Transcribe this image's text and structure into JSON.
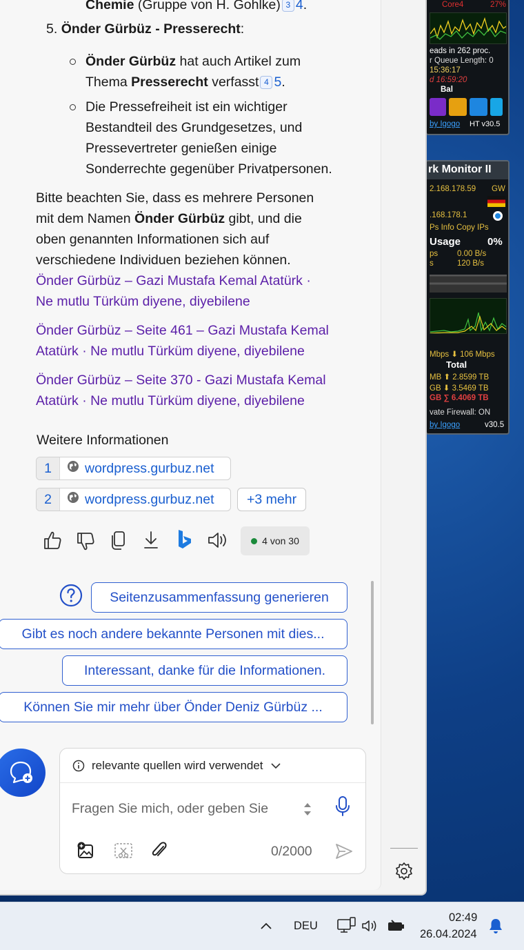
{
  "gadgets": {
    "cpu": {
      "core_label": "Core4",
      "core_value": "27%",
      "threads_line": "eads in 262 proc.",
      "queue_line": "r Queue Length: 0",
      "time1": "15:36:17",
      "time2": "d 16:59:20",
      "bal_label": "Bal",
      "footer": "by Igogo",
      "version": "HT v30.5"
    },
    "network": {
      "title": "rk Monitor II",
      "ip_gateway": "2.168.178.59",
      "gw_label": "GW",
      "ip_local": ".168.178.1",
      "links": "Ps   Info   Copy IPs",
      "usage_label": "Usage",
      "usage_value": "0%",
      "rate_ps": "ps",
      "rate_up": "0.00 B/s",
      "rate_s": "s",
      "rate_down": "120 B/s",
      "speed_line": "Mbps ⬇ 106 Mbps",
      "total_label": "Total",
      "total_up_line": "MB ⬆ 2.8599 TB",
      "total_down_line": "GB ⬇ 3.5469 TB",
      "sum_line": "GB ∑ 6.4069 TB",
      "firewall": "vate   Firewall: ON",
      "footer": "by Igogo",
      "version": "v30.5"
    }
  },
  "chat": {
    "top_line": {
      "bold": "Chemie",
      "rest": " (Gruppe von H. Gohlke)",
      "cite": "3",
      "num": "4",
      "tail": "."
    },
    "item5": {
      "number": "5.",
      "title": "Önder Gürbüz - Presserecht",
      "colon": ":"
    },
    "bullet1": {
      "line1_bold": "Önder Gürbüz",
      "line1_rest": " hat auch Artikel zum",
      "line2_pre": "Thema ",
      "line2_bold": "Presserecht",
      "line2_rest": " verfasst",
      "cite": "4",
      "num": "5",
      "tail": "."
    },
    "bullet2": [
      "Die Pressefreiheit ist ein wichtiger",
      "Bestandteil des Grundgesetzes, und",
      "Pressevertreter genießen einige",
      "Sonderrechte gegenüber Privatpersonen."
    ],
    "note": {
      "line1": "Bitte beachten Sie, dass es mehrere Personen",
      "line2_pre": "mit dem Namen ",
      "line2_bold": "Önder Gürbüz",
      "line2_rest": " gibt, und die",
      "line3": "oben genannten Informationen sich auf",
      "line4": "verschiedene Individuen beziehen können."
    },
    "links": [
      {
        "line1": "Önder Gürbüz – Gazi Mustafa Kemal Atatürk ·",
        "line2": "Ne mutlu Türküm diyene, diyebilene"
      },
      {
        "line1": "Önder Gürbüz – Seite 461 – Gazi Mustafa Kemal",
        "line2": "Atatürk · Ne mutlu Türküm diyene, diyebilene"
      },
      {
        "line1": "Önder Gürbüz – Seite 370 - Gazi Mustafa Kemal",
        "line2": "Atatürk · Ne mutlu Türküm diyene, diyebilene"
      }
    ],
    "sources_heading": "Weitere Informationen",
    "sources": [
      {
        "num": "1",
        "host": "wordpress.gurbuz.net"
      },
      {
        "num": "2",
        "host": "wordpress.gurbuz.net"
      }
    ],
    "more_label": "+3 mehr",
    "counter": "4 von 30",
    "suggestions": [
      "Seitenzusammenfassung generieren",
      "Gibt es noch andere bekannte Personen mit dies...",
      "Interessant, danke für die Informationen.",
      "Können Sie mir mehr über Önder Deniz Gürbüz ..."
    ],
    "composer": {
      "mode_label": "relevante quellen wird verwendet",
      "placeholder": "Fragen Sie mich, oder geben Sie",
      "char_count": "0/2000"
    }
  },
  "taskbar": {
    "language": "DEU",
    "time": "02:49",
    "date": "26.04.2024"
  },
  "colors": {
    "link": "#5b1fa8",
    "accent": "#2350c8",
    "fab": "#1f5ad8"
  }
}
